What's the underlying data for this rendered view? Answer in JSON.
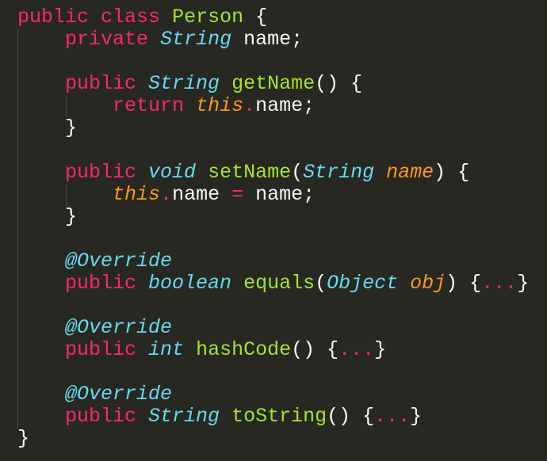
{
  "editor": {
    "lines": [
      {
        "tokens": [
          {
            "t": "public",
            "c": "kw"
          },
          {
            "t": " "
          },
          {
            "t": "class",
            "c": "kw"
          },
          {
            "t": " "
          },
          {
            "t": "Person",
            "c": "fn"
          },
          {
            "t": " {"
          }
        ]
      },
      {
        "tokens": [
          {
            "t": "    "
          },
          {
            "t": "private",
            "c": "kw"
          },
          {
            "t": " "
          },
          {
            "t": "String",
            "c": "ty"
          },
          {
            "t": " name;"
          }
        ]
      },
      {
        "tokens": []
      },
      {
        "tokens": [
          {
            "t": "    "
          },
          {
            "t": "public",
            "c": "kw"
          },
          {
            "t": " "
          },
          {
            "t": "String",
            "c": "ty"
          },
          {
            "t": " "
          },
          {
            "t": "getName",
            "c": "fn"
          },
          {
            "t": "() {"
          }
        ]
      },
      {
        "tokens": [
          {
            "t": "        "
          },
          {
            "t": "return",
            "c": "kw"
          },
          {
            "t": " "
          },
          {
            "t": "this",
            "c": "pn"
          },
          {
            "t": ".",
            "c": "kw"
          },
          {
            "t": "name;"
          }
        ]
      },
      {
        "tokens": [
          {
            "t": "    }"
          }
        ]
      },
      {
        "tokens": []
      },
      {
        "tokens": [
          {
            "t": "    "
          },
          {
            "t": "public",
            "c": "kw"
          },
          {
            "t": " "
          },
          {
            "t": "void",
            "c": "ty"
          },
          {
            "t": " "
          },
          {
            "t": "setName",
            "c": "fn"
          },
          {
            "t": "("
          },
          {
            "t": "String",
            "c": "ty"
          },
          {
            "t": " "
          },
          {
            "t": "name",
            "c": "pn"
          },
          {
            "t": ") {"
          }
        ]
      },
      {
        "tokens": [
          {
            "t": "        "
          },
          {
            "t": "this",
            "c": "pn"
          },
          {
            "t": ".",
            "c": "kw"
          },
          {
            "t": "name "
          },
          {
            "t": "=",
            "c": "kw"
          },
          {
            "t": " name;"
          }
        ]
      },
      {
        "tokens": [
          {
            "t": "    }"
          }
        ]
      },
      {
        "tokens": []
      },
      {
        "tokens": [
          {
            "t": "    "
          },
          {
            "t": "@Override",
            "c": "an"
          }
        ]
      },
      {
        "tokens": [
          {
            "t": "    "
          },
          {
            "t": "public",
            "c": "kw"
          },
          {
            "t": " "
          },
          {
            "t": "boolean",
            "c": "ty"
          },
          {
            "t": " "
          },
          {
            "t": "equals",
            "c": "fn"
          },
          {
            "t": "("
          },
          {
            "t": "Object",
            "c": "ty"
          },
          {
            "t": " "
          },
          {
            "t": "obj",
            "c": "pn"
          },
          {
            "t": ") {"
          },
          {
            "t": "...",
            "c": "kw"
          },
          {
            "t": "}"
          }
        ]
      },
      {
        "tokens": []
      },
      {
        "tokens": [
          {
            "t": "    "
          },
          {
            "t": "@Override",
            "c": "an"
          }
        ]
      },
      {
        "tokens": [
          {
            "t": "    "
          },
          {
            "t": "public",
            "c": "kw"
          },
          {
            "t": " "
          },
          {
            "t": "int",
            "c": "ty"
          },
          {
            "t": " "
          },
          {
            "t": "hashCode",
            "c": "fn"
          },
          {
            "t": "() {"
          },
          {
            "t": "...",
            "c": "kw"
          },
          {
            "t": "}"
          }
        ]
      },
      {
        "tokens": []
      },
      {
        "tokens": [
          {
            "t": "    "
          },
          {
            "t": "@Override",
            "c": "an"
          }
        ]
      },
      {
        "tokens": [
          {
            "t": "    "
          },
          {
            "t": "public",
            "c": "kw"
          },
          {
            "t": " "
          },
          {
            "t": "String",
            "c": "ty"
          },
          {
            "t": " "
          },
          {
            "t": "toString",
            "c": "fn"
          },
          {
            "t": "() {"
          },
          {
            "t": "...",
            "c": "kw"
          },
          {
            "t": "}"
          }
        ]
      },
      {
        "tokens": [
          {
            "t": "}"
          }
        ]
      }
    ]
  },
  "theme": {
    "background": "#272822",
    "keyword": "#f92672",
    "type": "#66d9ef",
    "function": "#a6e22e",
    "parameter": "#fd971f",
    "plain": "#f8f8f2",
    "indent_guide": "#46473f"
  }
}
